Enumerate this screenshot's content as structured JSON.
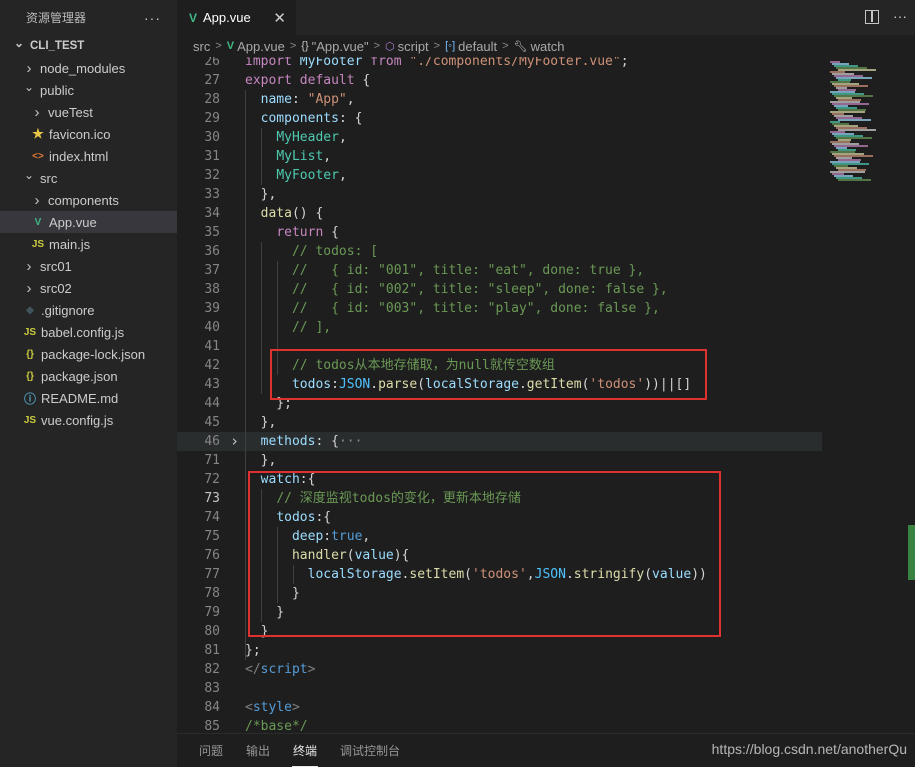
{
  "sidebar": {
    "title": "资源管理器",
    "more": "···",
    "items": [
      {
        "label": "CLI_TEST",
        "depth": 0,
        "type": "folder-open",
        "root": true
      },
      {
        "label": "node_modules",
        "depth": 1,
        "type": "folder"
      },
      {
        "label": "public",
        "depth": 1,
        "type": "folder-open"
      },
      {
        "label": "vueTest",
        "depth": 2,
        "type": "folder"
      },
      {
        "label": "favicon.ico",
        "depth": 2,
        "type": "star"
      },
      {
        "label": "index.html",
        "depth": 2,
        "type": "html"
      },
      {
        "label": "src",
        "depth": 1,
        "type": "folder-open"
      },
      {
        "label": "components",
        "depth": 2,
        "type": "folder"
      },
      {
        "label": "App.vue",
        "depth": 2,
        "type": "vue",
        "selected": true
      },
      {
        "label": "main.js",
        "depth": 2,
        "type": "js"
      },
      {
        "label": "src01",
        "depth": 1,
        "type": "folder"
      },
      {
        "label": "src02",
        "depth": 1,
        "type": "folder"
      },
      {
        "label": ".gitignore",
        "depth": 1,
        "type": "git"
      },
      {
        "label": "babel.config.js",
        "depth": 1,
        "type": "js"
      },
      {
        "label": "package-lock.json",
        "depth": 1,
        "type": "json"
      },
      {
        "label": "package.json",
        "depth": 1,
        "type": "json"
      },
      {
        "label": "README.md",
        "depth": 1,
        "type": "info"
      },
      {
        "label": "vue.config.js",
        "depth": 1,
        "type": "js"
      }
    ]
  },
  "tabs": {
    "active": "App.vue",
    "close": "✕",
    "more": "···"
  },
  "breadcrumb": [
    "src",
    "App.vue",
    "\"App.vue\"",
    "script",
    "default",
    "watch"
  ],
  "editor": {
    "lines": [
      {
        "n": "26",
        "html": "<span class='kw'>import</span> <span class='pr'>MyFooter</span> <span class='kw'>from</span> <span class='st'>\"./components/MyFooter.vue\"</span>;"
      },
      {
        "n": "27",
        "html": "<span class='kw'>export</span> <span class='kw'>default</span> {"
      },
      {
        "n": "28",
        "html": "  <span class='pr'>name</span>: <span class='st'>\"App\"</span>,"
      },
      {
        "n": "29",
        "html": "  <span class='pr'>components</span>: {"
      },
      {
        "n": "30",
        "html": "    <span class='cl'>MyHeader</span>,"
      },
      {
        "n": "31",
        "html": "    <span class='cl'>MyList</span>,"
      },
      {
        "n": "32",
        "html": "    <span class='cl'>MyFooter</span>,"
      },
      {
        "n": "33",
        "html": "  },"
      },
      {
        "n": "34",
        "html": "  <span class='fn'>data</span>() {"
      },
      {
        "n": "35",
        "html": "    <span class='kw'>return</span> {"
      },
      {
        "n": "36",
        "html": "      <span class='cm'>// todos: [</span>"
      },
      {
        "n": "37",
        "html": "      <span class='cm'>//   { id: \"001\", title: \"eat\", done: true },</span>"
      },
      {
        "n": "38",
        "html": "      <span class='cm'>//   { id: \"002\", title: \"sleep\", done: false },</span>"
      },
      {
        "n": "39",
        "html": "      <span class='cm'>//   { id: \"003\", title: \"play\", done: false },</span>"
      },
      {
        "n": "40",
        "html": "      <span class='cm'>// ],</span>"
      },
      {
        "n": "41",
        "html": ""
      },
      {
        "n": "42",
        "html": "      <span class='cm'>// todos从本地存储取，为null就传空数组</span>"
      },
      {
        "n": "43",
        "html": "      <span class='pr'>todos</span>:<span class='cv'>JSON</span>.<span class='fn'>parse</span>(<span class='pr'>localStorage</span>.<span class='fn'>getItem</span>(<span class='st'>'todos'</span>))||[]"
      },
      {
        "n": "44",
        "html": "    };"
      },
      {
        "n": "45",
        "html": "  },"
      },
      {
        "n": "46",
        "html": "  <span class='pr'>methods</span>: {<span class='fold-ell'>···</span>",
        "hl": true,
        "fold": true
      },
      {
        "n": "71",
        "html": "  },"
      },
      {
        "n": "72",
        "html": "  <span class='pr'>watch</span>:{"
      },
      {
        "n": "73",
        "html": "    <span class='cm'>// 深度监视todos的变化，更新本地存储</span>",
        "cur": true
      },
      {
        "n": "74",
        "html": "    <span class='pr'>todos</span>:{"
      },
      {
        "n": "75",
        "html": "      <span class='pr'>deep</span>:<span class='kb'>true</span>,"
      },
      {
        "n": "76",
        "html": "      <span class='fn'>handler</span>(<span class='pr'>value</span>){"
      },
      {
        "n": "77",
        "html": "        <span class='pr'>localStorage</span>.<span class='fn'>setItem</span>(<span class='st'>'todos'</span>,<span class='cv'>JSON</span>.<span class='fn'>stringify</span>(<span class='pr'>value</span>))"
      },
      {
        "n": "78",
        "html": "      }"
      },
      {
        "n": "79",
        "html": "    }"
      },
      {
        "n": "80",
        "html": "  }"
      },
      {
        "n": "81",
        "html": "};"
      },
      {
        "n": "82",
        "html": "<span class='tg'>&lt;/</span><span class='tn'>script</span><span class='tg'>&gt;</span>"
      },
      {
        "n": "83",
        "html": ""
      },
      {
        "n": "84",
        "html": "<span class='tg'>&lt;</span><span class='tn'>style</span><span class='tg'>&gt;</span>"
      },
      {
        "n": "85",
        "html": "<span class='cm'>/*base*/</span>"
      }
    ]
  },
  "panel": {
    "tabs": [
      "问题",
      "输出",
      "终端",
      "调试控制台"
    ],
    "active": "终端",
    "watermark": "https://blog.csdn.net/anotherQu"
  },
  "colors": {
    "annotation": "#e03131",
    "vue": "#41b883"
  }
}
